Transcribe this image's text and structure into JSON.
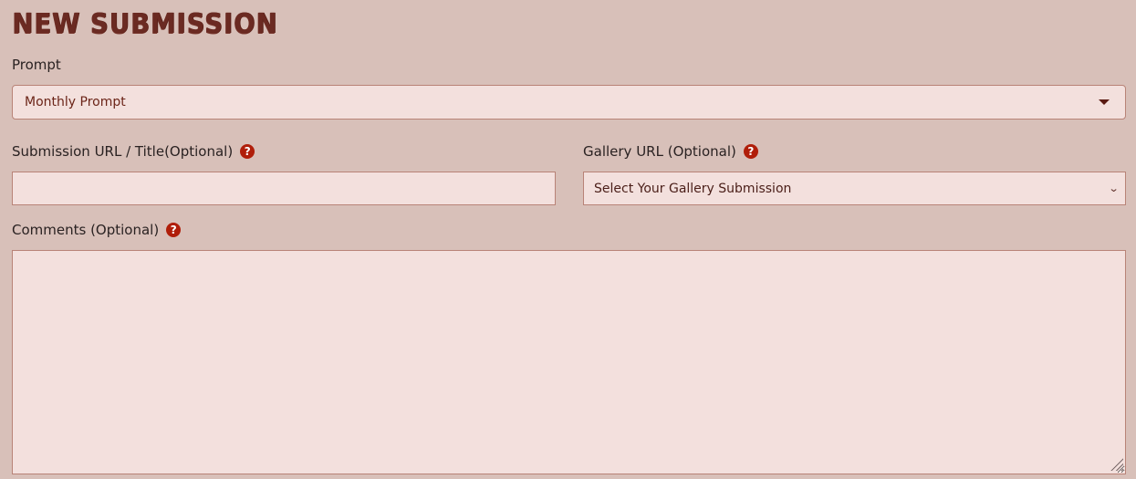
{
  "page": {
    "title": "NEW SUBMISSION"
  },
  "prompt": {
    "label": "Prompt",
    "selected": "Monthly Prompt"
  },
  "submission_url": {
    "label": "Submission URL / Title(Optional)",
    "value": "",
    "help_icon": "?"
  },
  "gallery_url": {
    "label": "Gallery URL (Optional)",
    "selected": "Select Your Gallery Submission",
    "help_icon": "?"
  },
  "comments": {
    "label": "Comments (Optional)",
    "value": "",
    "help_icon": "?"
  },
  "icons": {
    "help": "question-circle-icon",
    "dropdown": "caret-down-icon",
    "chevron": "chevron-down-icon",
    "chevron_glyph": "⌄"
  },
  "colors": {
    "background": "#d8c0b9",
    "field_background": "#f3e0dd",
    "field_border": "#b88377",
    "title": "#6b2a22",
    "help_icon": "#b01e0a"
  }
}
